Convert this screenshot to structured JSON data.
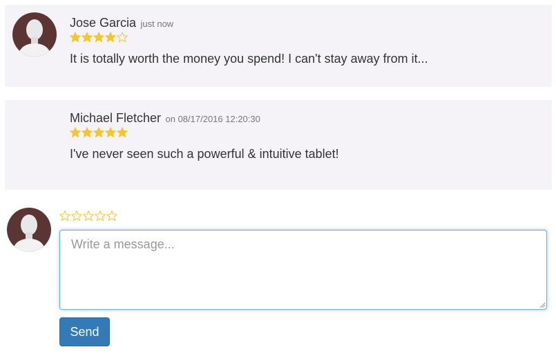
{
  "colors": {
    "star_filled": "#f5c62b",
    "star_outline": "#f5c62b",
    "review_background": "#f5f3f7",
    "send_button": "#337ab7",
    "avatar_background": "#5b3534"
  },
  "reviews": [
    {
      "author": "Jose Garcia",
      "meta": "just now",
      "rating": 4,
      "max_rating": 5,
      "comment": "It is totally worth the money you spend! I can't stay away from it...",
      "has_avatar": true
    },
    {
      "author": "Michael Fletcher",
      "meta": "on 08/17/2016 12:20:30",
      "rating": 5,
      "max_rating": 5,
      "comment": "I've never seen such a powerful & intuitive tablet!",
      "has_avatar": false
    }
  ],
  "composer": {
    "rating": 0,
    "max_rating": 5,
    "placeholder": "Write a message...",
    "value": "",
    "send_label": "Send"
  }
}
